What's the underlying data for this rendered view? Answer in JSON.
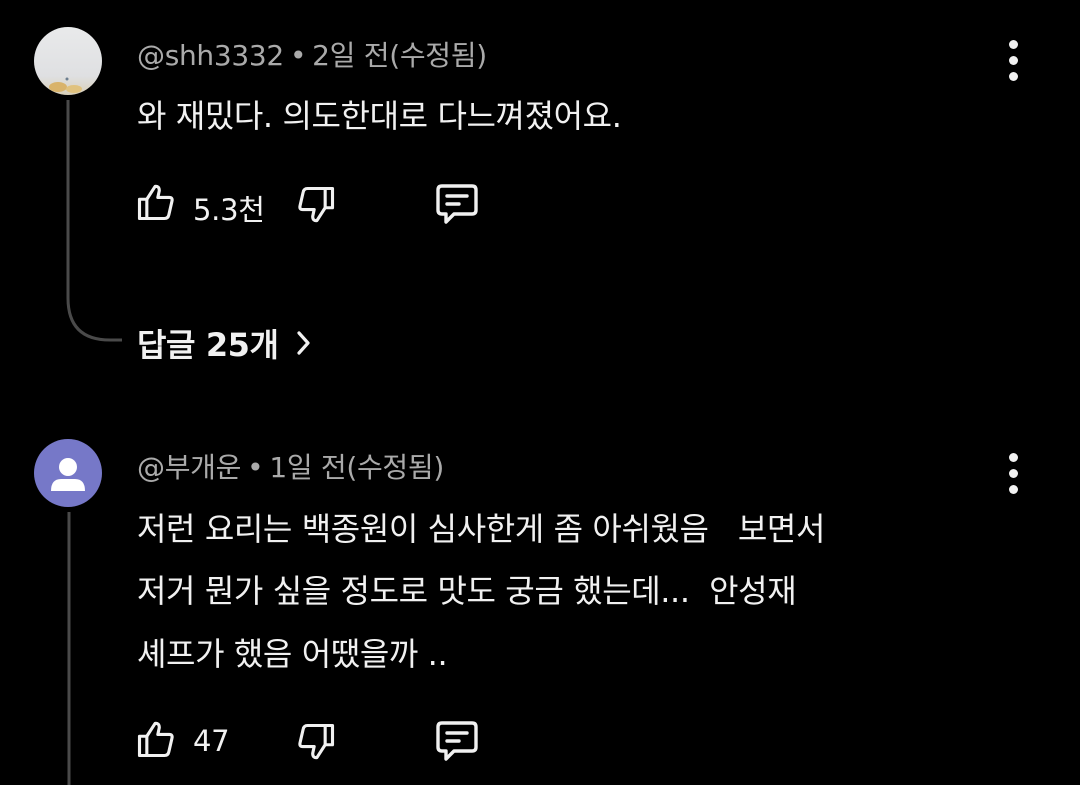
{
  "comments": [
    {
      "handle": "@shh3332",
      "separator": "•",
      "time": "2일 전(수정됨)",
      "lines": [
        "와 재밌다. 의도한대로 다느껴졌어요."
      ],
      "likes": "5.3천",
      "replies_label": "답글 25개"
    },
    {
      "handle": "@부개운",
      "separator": "•",
      "time": "1일 전(수정됨)",
      "lines": [
        "저런 요리는 백종원이 심사한게 좀 아쉬웠음   보면서",
        "저거 뭔가 싶을 정도로 맛도 궁금 했는데...  안성재",
        "셰프가 했음 어땠을까 .."
      ],
      "likes": "47"
    }
  ],
  "icons": {
    "like": "thumbs-up-icon",
    "dislike": "thumbs-down-icon",
    "reply": "comment-icon",
    "more": "more-vertical-icon",
    "chevron": "chevron-right-icon"
  },
  "colors": {
    "background": "#000000",
    "text": "#f1f1f1",
    "meta": "#aaaaaa",
    "default_avatar": "#7678c8"
  }
}
